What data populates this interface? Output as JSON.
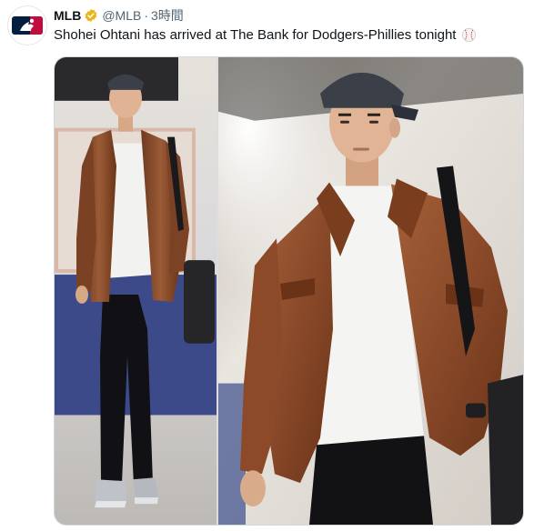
{
  "account": {
    "name": "MLB",
    "handle": "@MLB",
    "separator": "·",
    "time": "3時間",
    "avatar_icon": "mlb-logo-icon",
    "verified_icon": "verified-badge-icon",
    "verified_color": "#e8b51a"
  },
  "tweet": {
    "text": "Shohei Ohtani has arrived at The Bank for Dodgers-Phillies tonight",
    "emoji_icon": "baseball-icon"
  },
  "media": {
    "count": 2,
    "photos": [
      {
        "name": "photo-full-body"
      },
      {
        "name": "photo-closeup"
      }
    ]
  },
  "colors": {
    "text": "#0f1419",
    "secondary": "#536471",
    "mlb_blue": "#041e42",
    "mlb_red": "#bf0d3e",
    "jacket": "#8a4a2a"
  }
}
